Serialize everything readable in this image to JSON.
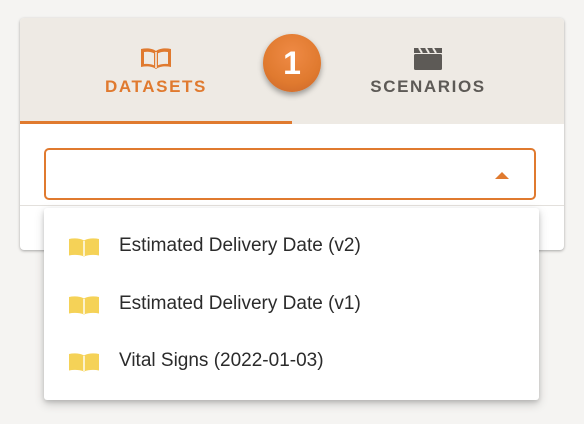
{
  "tabs": [
    {
      "label": "DATASETS",
      "icon": "book-icon",
      "active": true
    },
    {
      "label": "SCENARIOS",
      "icon": "clapperboard-icon",
      "active": false
    }
  ],
  "step_badge": "1",
  "select": {
    "value": "",
    "expanded": true
  },
  "dropdown": {
    "options": [
      {
        "label": "Estimated Delivery Date (v2)",
        "icon": "book-icon"
      },
      {
        "label": "Estimated Delivery Date (v1)",
        "icon": "book-icon"
      },
      {
        "label": "Vital Signs (2022-01-03)",
        "icon": "book-icon"
      }
    ]
  },
  "colors": {
    "accent": "#e07a2f",
    "tab_bar": "#eeeae4",
    "inactive_tab": "#5d5a56",
    "option_icon": "#f5d257"
  }
}
